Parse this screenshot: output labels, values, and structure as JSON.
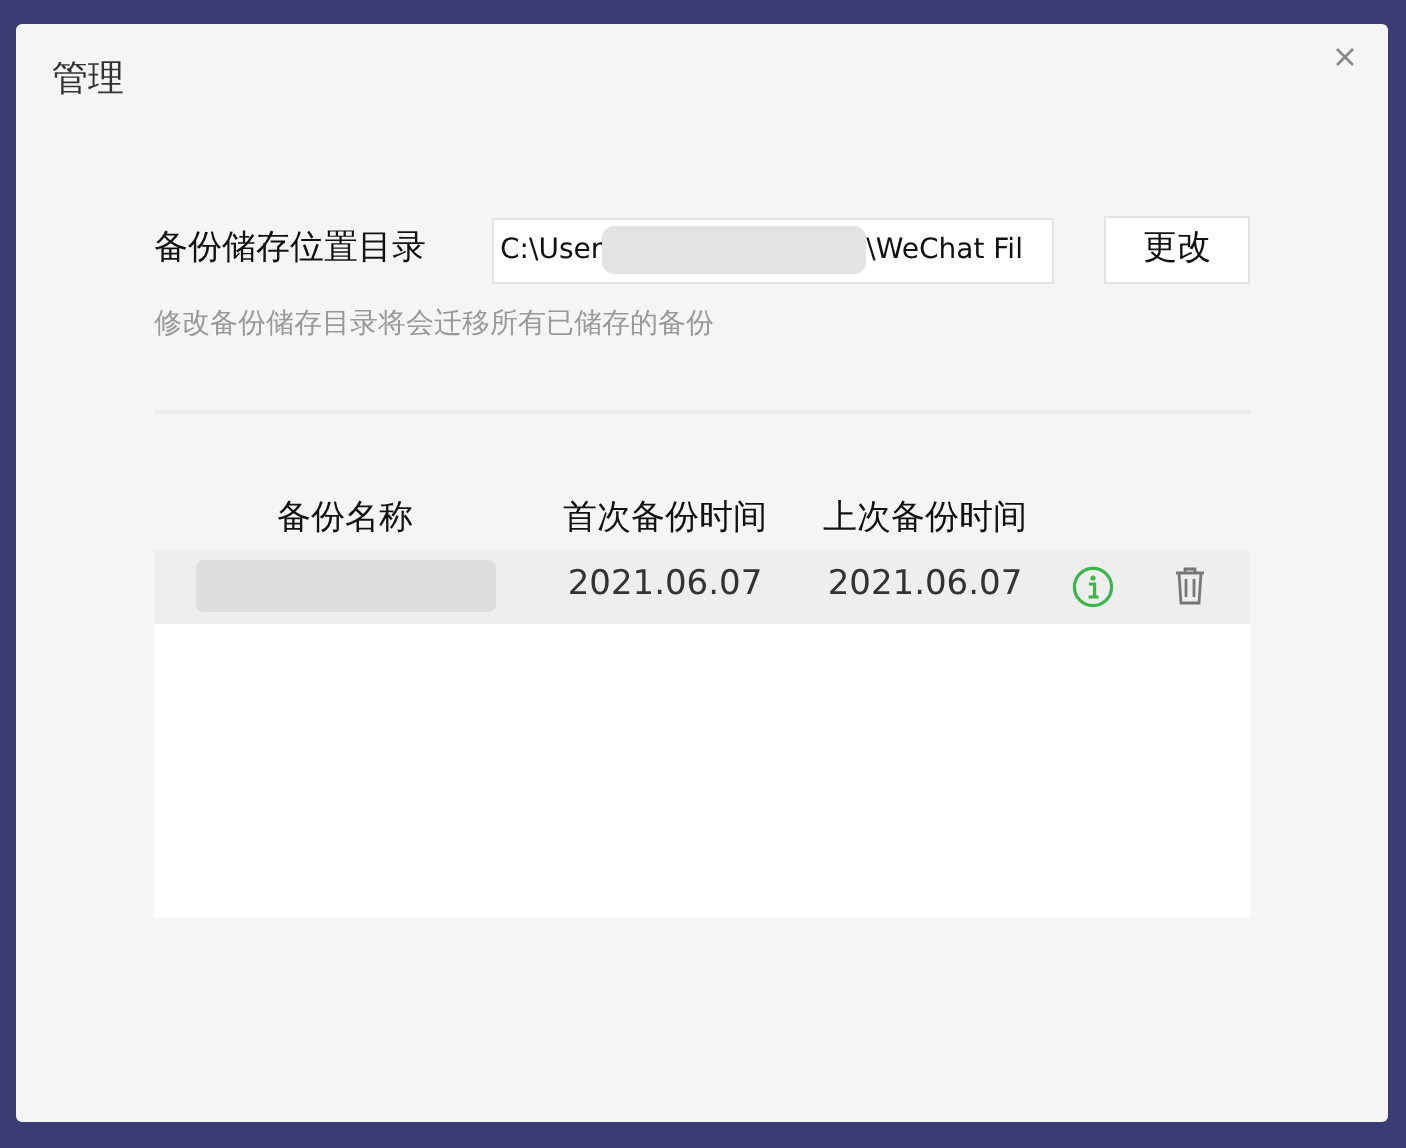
{
  "window": {
    "title": "管理"
  },
  "location": {
    "label": "备份储存位置目录",
    "path_start": "C:\\User",
    "path_end": "\\WeChat Fil",
    "button": "更改",
    "hint": "修改备份储存目录将会迁移所有已储存的备份"
  },
  "table": {
    "columns": [
      "备份名称",
      "首次备份时间",
      "上次备份时间"
    ],
    "rows": [
      {
        "first": "2021.06.07",
        "last": "2021.06.07",
        "selected": true
      }
    ]
  }
}
